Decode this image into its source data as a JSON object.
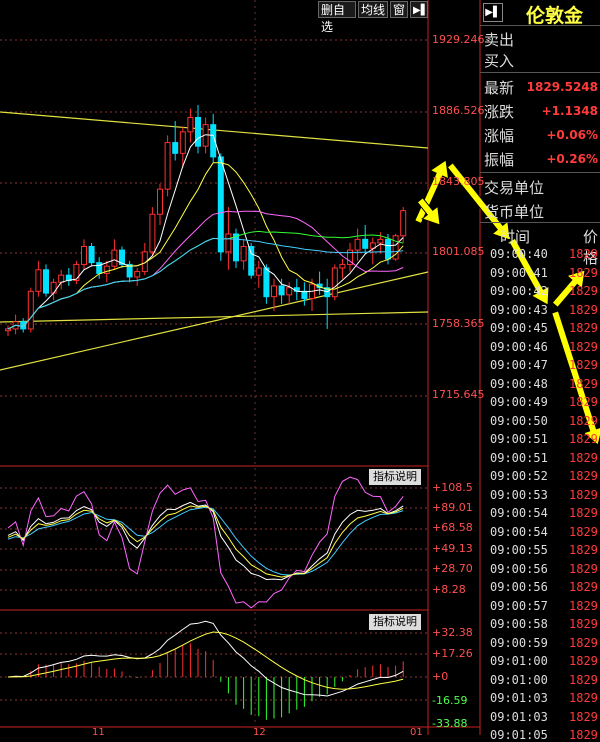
{
  "toolbar": {
    "delete_watch_label": "删自选",
    "ma_label": "均线",
    "window_label": "窗"
  },
  "quote_panel": {
    "title": "伦敦金",
    "sell_label": "卖出",
    "buy_label": "买入",
    "latest_label": "最新",
    "latest_value": "1829.5248",
    "change_label": "涨跌",
    "change_value": "+1.1348",
    "change_pct_label": "涨幅",
    "change_pct_value": "+0.06%",
    "amplitude_label": "振幅",
    "amplitude_value": "+0.26%",
    "trade_unit_label": "交易单位",
    "currency_unit_label": "货币单位"
  },
  "ticks": {
    "time_header": "时间",
    "price_header": "价格",
    "rows": [
      {
        "time": "09:00:40",
        "price": "1829."
      },
      {
        "time": "09:00:41",
        "price": "1829."
      },
      {
        "time": "09:00:42",
        "price": "1829."
      },
      {
        "time": "09:00:43",
        "price": "1829."
      },
      {
        "time": "09:00:45",
        "price": "1829."
      },
      {
        "time": "09:00:46",
        "price": "1829."
      },
      {
        "time": "09:00:47",
        "price": "1829."
      },
      {
        "time": "09:00:48",
        "price": "1829."
      },
      {
        "time": "09:00:49",
        "price": "1829."
      },
      {
        "time": "09:00:50",
        "price": "1829."
      },
      {
        "time": "09:00:51",
        "price": "1829."
      },
      {
        "time": "09:00:51",
        "price": "1829."
      },
      {
        "time": "09:00:52",
        "price": "1829."
      },
      {
        "time": "09:00:53",
        "price": "1829."
      },
      {
        "time": "09:00:54",
        "price": "1829."
      },
      {
        "time": "09:00:54",
        "price": "1829."
      },
      {
        "time": "09:00:55",
        "price": "1829."
      },
      {
        "time": "09:00:56",
        "price": "1829."
      },
      {
        "time": "09:00:56",
        "price": "1829."
      },
      {
        "time": "09:00:57",
        "price": "1829."
      },
      {
        "time": "09:00:58",
        "price": "1829."
      },
      {
        "time": "09:00:59",
        "price": "1829."
      },
      {
        "time": "09:01:00",
        "price": "1829."
      },
      {
        "time": "09:01:00",
        "price": "1829."
      },
      {
        "time": "09:01:03",
        "price": "1829."
      },
      {
        "time": "09:01:03",
        "price": "1829."
      },
      {
        "time": "09:01:05",
        "price": "1829."
      }
    ]
  },
  "main_axis": {
    "ticks": [
      "1929.246",
      "1886.526",
      "1843.805",
      "1801.085",
      "1758.365",
      "1715.645"
    ]
  },
  "indicator1": {
    "label": "指标说明",
    "ticks": [
      "+108.5",
      "+89.01",
      "+68.58",
      "+49.13",
      "+28.70",
      "+8.28"
    ]
  },
  "indicator2": {
    "label": "指标说明",
    "ticks": [
      "+32.38",
      "+17.26",
      "+0",
      "-16.59",
      "-33.88"
    ]
  },
  "date_axis": {
    "labels": [
      "11",
      "12",
      "01"
    ]
  },
  "chart_data": {
    "type": "candlestick",
    "price_range": [
      1700,
      1940
    ],
    "colors": {
      "up": "#ff3030",
      "down": "#00e0ff",
      "trendline": "#e0e040",
      "annotation": "#ffff00"
    },
    "candles": [
      [
        1761,
        1764,
        1758,
        1762
      ],
      [
        1762,
        1770,
        1759,
        1766
      ],
      [
        1766,
        1768,
        1760,
        1762
      ],
      [
        1762,
        1785,
        1760,
        1783
      ],
      [
        1783,
        1800,
        1780,
        1795
      ],
      [
        1795,
        1798,
        1780,
        1782
      ],
      [
        1782,
        1790,
        1778,
        1788
      ],
      [
        1788,
        1795,
        1784,
        1792
      ],
      [
        1792,
        1796,
        1786,
        1789
      ],
      [
        1789,
        1800,
        1787,
        1798
      ],
      [
        1798,
        1812,
        1795,
        1808
      ],
      [
        1808,
        1810,
        1797,
        1799
      ],
      [
        1799,
        1802,
        1790,
        1793
      ],
      [
        1793,
        1800,
        1788,
        1797
      ],
      [
        1797,
        1812,
        1795,
        1806
      ],
      [
        1806,
        1808,
        1796,
        1798
      ],
      [
        1798,
        1800,
        1788,
        1791
      ],
      [
        1791,
        1796,
        1786,
        1794
      ],
      [
        1794,
        1810,
        1792,
        1805
      ],
      [
        1805,
        1830,
        1803,
        1826
      ],
      [
        1826,
        1843,
        1820,
        1840
      ],
      [
        1840,
        1870,
        1836,
        1866
      ],
      [
        1866,
        1878,
        1856,
        1860
      ],
      [
        1860,
        1875,
        1852,
        1872
      ],
      [
        1872,
        1885,
        1866,
        1880
      ],
      [
        1880,
        1887,
        1860,
        1864
      ],
      [
        1864,
        1880,
        1860,
        1876
      ],
      [
        1876,
        1882,
        1855,
        1858
      ],
      [
        1858,
        1860,
        1800,
        1805
      ],
      [
        1805,
        1830,
        1795,
        1815
      ],
      [
        1815,
        1818,
        1796,
        1800
      ],
      [
        1800,
        1812,
        1795,
        1808
      ],
      [
        1808,
        1810,
        1790,
        1792
      ],
      [
        1792,
        1800,
        1785,
        1796
      ],
      [
        1796,
        1798,
        1776,
        1780
      ],
      [
        1780,
        1790,
        1772,
        1786
      ],
      [
        1786,
        1790,
        1776,
        1781
      ],
      [
        1781,
        1788,
        1776,
        1785
      ],
      [
        1785,
        1790,
        1778,
        1783
      ],
      [
        1783,
        1788,
        1775,
        1779
      ],
      [
        1779,
        1790,
        1772,
        1787
      ],
      [
        1787,
        1794,
        1781,
        1785
      ],
      [
        1785,
        1790,
        1762,
        1780
      ],
      [
        1780,
        1798,
        1778,
        1796
      ],
      [
        1796,
        1801,
        1790,
        1798
      ],
      [
        1798,
        1810,
        1794,
        1806
      ],
      [
        1806,
        1818,
        1800,
        1812
      ],
      [
        1812,
        1820,
        1804,
        1807
      ],
      [
        1807,
        1813,
        1798,
        1810
      ],
      [
        1810,
        1816,
        1804,
        1812
      ],
      [
        1812,
        1815,
        1798,
        1801
      ],
      [
        1801,
        1815,
        1800,
        1814
      ],
      [
        1814,
        1830,
        1810,
        1828
      ]
    ]
  }
}
